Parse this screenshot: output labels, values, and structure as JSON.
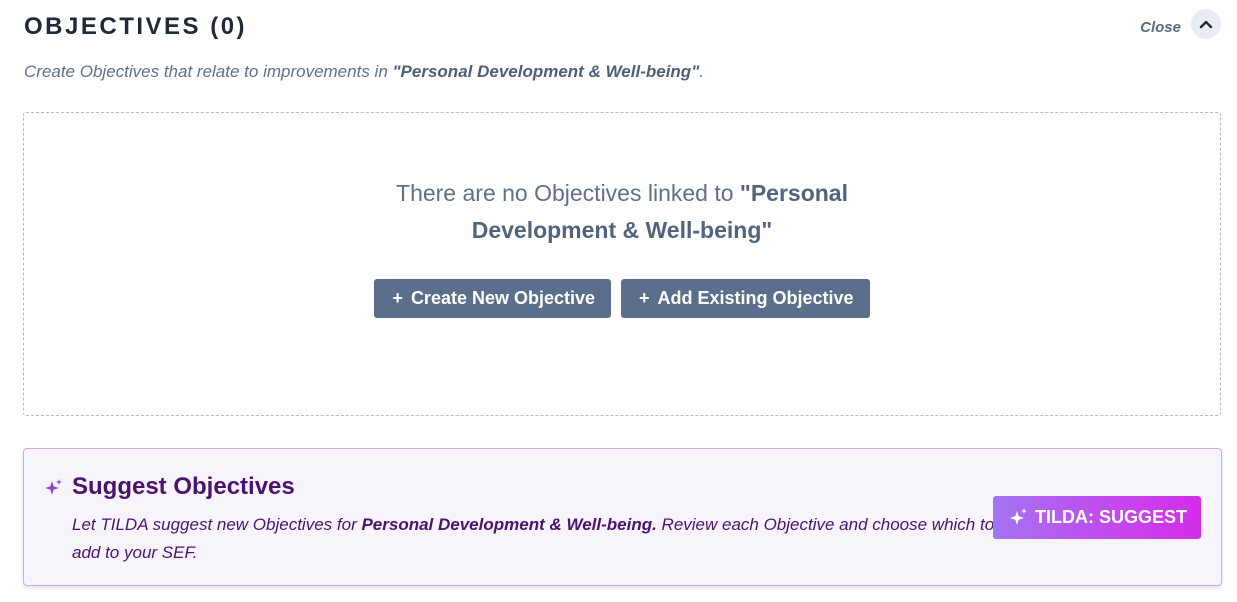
{
  "header": {
    "title": "OBJECTIVES (0)",
    "close_label": "Close"
  },
  "subtitle": {
    "prefix": "Create Objectives that relate to improvements in ",
    "area": "\"Personal Development & Well-being\"",
    "suffix": "."
  },
  "empty_state": {
    "message": "There are no Objectives linked to ",
    "area": "\"Personal Development & Well-being\"",
    "create_label": "Create New Objective",
    "add_label": "Add Existing Objective"
  },
  "suggest": {
    "title": "Suggest Objectives",
    "desc_prefix": "Let TILDA suggest new Objectives for ",
    "desc_area": "Personal Development & Well-being.",
    "desc_suffix": " Review each Objective and choose which to add to your SEF.",
    "button_label": "TILDA: SUGGEST"
  },
  "colors": {
    "primary_button": "#5b6f8c",
    "suggest_text": "#4a1370",
    "suggest_border": "#d5a8e4",
    "suggest_bg": "#f8f4fb"
  },
  "icons": {
    "collapse": "chevron-up-icon",
    "plus": "plus-icon",
    "sparkle": "sparkle-icon"
  }
}
